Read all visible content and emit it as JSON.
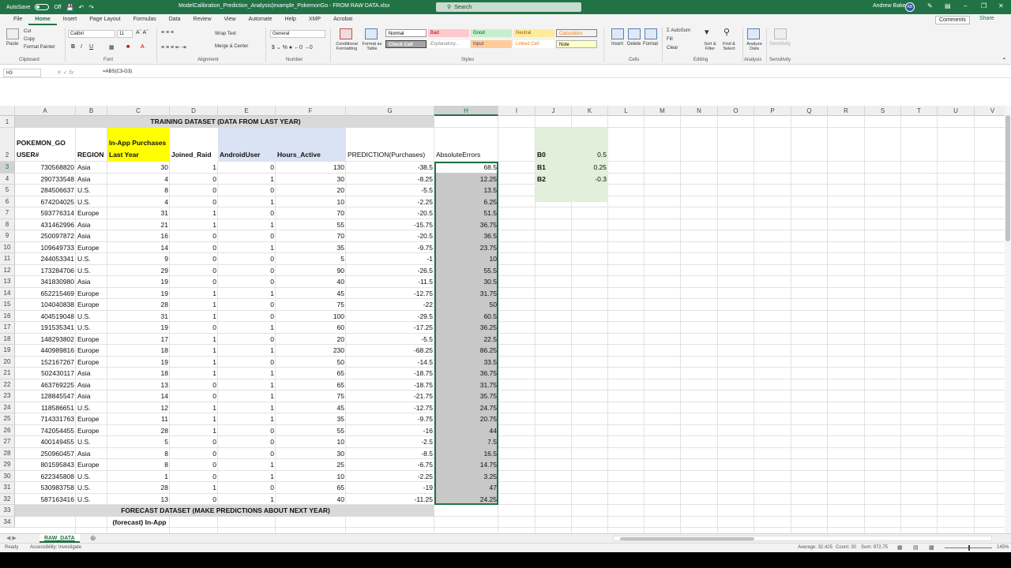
{
  "titlebar": {
    "autosave": "AutoSave",
    "autosave_state": "Off",
    "doc_title": "ModelCalibration_Prediction_Analysis(example_PokemonGo - FROM RAW DATA.xlsx",
    "search_placeholder": "Search",
    "user_name": "Andrew Baker",
    "user_initials": "AB"
  },
  "ribbon_tabs": [
    "File",
    "Home",
    "Insert",
    "Page Layout",
    "Formulas",
    "Data",
    "Review",
    "View",
    "Automate",
    "Help",
    "XMP",
    "Acrobat"
  ],
  "active_tab": "Home",
  "comments_label": "Comments",
  "share_label": "Share",
  "ribbon": {
    "clipboard": {
      "label": "Clipboard",
      "paste": "Paste",
      "cut": "Cut",
      "copy": "Copy",
      "format_painter": "Format Painter"
    },
    "font": {
      "label": "Font",
      "name": "Calibri",
      "size": "11"
    },
    "alignment": {
      "label": "Alignment",
      "wrap": "Wrap Text",
      "merge": "Merge & Center"
    },
    "number": {
      "label": "Number",
      "format": "General"
    },
    "styles": {
      "label": "Styles",
      "conditional": "Conditional Formatting",
      "format_table": "Format as Table",
      "cells": [
        "Normal",
        "Bad",
        "Good",
        "Neutral",
        "Calculation",
        "Check Cell",
        "Explanatory...",
        "Input",
        "Linked Cell",
        "Note"
      ]
    },
    "cells_group": {
      "label": "Cells",
      "insert": "Insert",
      "delete": "Delete",
      "format": "Format"
    },
    "editing": {
      "label": "Editing",
      "autosum": "AutoSum",
      "fill": "Fill",
      "clear": "Clear",
      "sort": "Sort & Filter",
      "find": "Find & Select"
    },
    "analysis": {
      "label": "Analysis",
      "analyze": "Analyze Data"
    },
    "sensitivity": {
      "label": "Sensitivity",
      "btn": "Sensitivity"
    }
  },
  "formula_bar": {
    "name_box": "H3",
    "formula": "=ABS(C3-G3)"
  },
  "columns": [
    "A",
    "B",
    "C",
    "D",
    "E",
    "F",
    "G",
    "H",
    "I",
    "J",
    "K",
    "L",
    "M",
    "N",
    "O",
    "P",
    "Q",
    "R",
    "S",
    "T",
    "U",
    "V"
  ],
  "headers": {
    "title": "TRAINING DATASET (DATA FROM LAST YEAR)",
    "a2_top": "POKEMON_GO",
    "a2": "USER#",
    "b2": "REGION",
    "c2_top": "In-App Purchases",
    "c2": "Last Year",
    "d2": "Joined_Raid",
    "e2": "AndroidUser",
    "f2": "Hours_Active",
    "g2": "PREDICTION(Purchases)",
    "h2": "AbsoluteErrors",
    "forecast_title": "FORECAST DATASET (MAKE PREDICTIONS ABOUT NEXT YEAR)",
    "c34": "(forecast) In-App"
  },
  "params": [
    {
      "name": "B0",
      "value": "0.5"
    },
    {
      "name": "B1",
      "value": "0.25"
    },
    {
      "name": "B2",
      "value": "-0.3"
    }
  ],
  "rows": [
    {
      "r": "3",
      "a": "730568820",
      "b": "Asia",
      "c": "30",
      "d": "1",
      "e": "0",
      "f": "130",
      "g": "-38.5",
      "h": "68.5"
    },
    {
      "r": "4",
      "a": "290733548",
      "b": "Asia",
      "c": "4",
      "d": "0",
      "e": "1",
      "f": "30",
      "g": "-8.25",
      "h": "12.25"
    },
    {
      "r": "5",
      "a": "284506637",
      "b": "U.S.",
      "c": "8",
      "d": "0",
      "e": "0",
      "f": "20",
      "g": "-5.5",
      "h": "13.5"
    },
    {
      "r": "6",
      "a": "674204025",
      "b": "U.S.",
      "c": "4",
      "d": "0",
      "e": "1",
      "f": "10",
      "g": "-2.25",
      "h": "6.25"
    },
    {
      "r": "7",
      "a": "593776314",
      "b": "Europe",
      "c": "31",
      "d": "1",
      "e": "0",
      "f": "70",
      "g": "-20.5",
      "h": "51.5"
    },
    {
      "r": "8",
      "a": "431462996",
      "b": "Asia",
      "c": "21",
      "d": "1",
      "e": "1",
      "f": "55",
      "g": "-15.75",
      "h": "36.75"
    },
    {
      "r": "9",
      "a": "250097872",
      "b": "Asia",
      "c": "16",
      "d": "0",
      "e": "0",
      "f": "70",
      "g": "-20.5",
      "h": "36.5"
    },
    {
      "r": "10",
      "a": "109649733",
      "b": "Europe",
      "c": "14",
      "d": "0",
      "e": "1",
      "f": "35",
      "g": "-9.75",
      "h": "23.75"
    },
    {
      "r": "11",
      "a": "244053341",
      "b": "U.S.",
      "c": "9",
      "d": "0",
      "e": "0",
      "f": "5",
      "g": "-1",
      "h": "10"
    },
    {
      "r": "12",
      "a": "173284706",
      "b": "U.S.",
      "c": "29",
      "d": "0",
      "e": "0",
      "f": "90",
      "g": "-26.5",
      "h": "55.5"
    },
    {
      "r": "13",
      "a": "341830980",
      "b": "Asia",
      "c": "19",
      "d": "0",
      "e": "0",
      "f": "40",
      "g": "-11.5",
      "h": "30.5"
    },
    {
      "r": "14",
      "a": "652215469",
      "b": "Europe",
      "c": "19",
      "d": "1",
      "e": "1",
      "f": "45",
      "g": "-12.75",
      "h": "31.75"
    },
    {
      "r": "15",
      "a": "104040838",
      "b": "Europe",
      "c": "28",
      "d": "1",
      "e": "0",
      "f": "75",
      "g": "-22",
      "h": "50"
    },
    {
      "r": "16",
      "a": "404519048",
      "b": "U.S.",
      "c": "31",
      "d": "1",
      "e": "0",
      "f": "100",
      "g": "-29.5",
      "h": "60.5"
    },
    {
      "r": "17",
      "a": "191535341",
      "b": "U.S.",
      "c": "19",
      "d": "0",
      "e": "1",
      "f": "60",
      "g": "-17.25",
      "h": "36.25"
    },
    {
      "r": "18",
      "a": "148293802",
      "b": "Europe",
      "c": "17",
      "d": "1",
      "e": "0",
      "f": "20",
      "g": "-5.5",
      "h": "22.5"
    },
    {
      "r": "19",
      "a": "440989816",
      "b": "Europe",
      "c": "18",
      "d": "1",
      "e": "1",
      "f": "230",
      "g": "-68.25",
      "h": "86.25"
    },
    {
      "r": "20",
      "a": "152167267",
      "b": "Europe",
      "c": "19",
      "d": "1",
      "e": "0",
      "f": "50",
      "g": "-14.5",
      "h": "33.5"
    },
    {
      "r": "21",
      "a": "502430117",
      "b": "Asia",
      "c": "18",
      "d": "1",
      "e": "1",
      "f": "65",
      "g": "-18.75",
      "h": "36.75"
    },
    {
      "r": "22",
      "a": "463769225",
      "b": "Asia",
      "c": "13",
      "d": "0",
      "e": "1",
      "f": "65",
      "g": "-18.75",
      "h": "31.75"
    },
    {
      "r": "23",
      "a": "128845547",
      "b": "Asia",
      "c": "14",
      "d": "0",
      "e": "1",
      "f": "75",
      "g": "-21.75",
      "h": "35.75"
    },
    {
      "r": "24",
      "a": "118586651",
      "b": "U.S.",
      "c": "12",
      "d": "1",
      "e": "1",
      "f": "45",
      "g": "-12.75",
      "h": "24.75"
    },
    {
      "r": "25",
      "a": "714331763",
      "b": "Europe",
      "c": "11",
      "d": "1",
      "e": "1",
      "f": "35",
      "g": "-9.75",
      "h": "20.75"
    },
    {
      "r": "26",
      "a": "742054455",
      "b": "Europe",
      "c": "28",
      "d": "1",
      "e": "0",
      "f": "55",
      "g": "-16",
      "h": "44"
    },
    {
      "r": "27",
      "a": "400149455",
      "b": "U.S.",
      "c": "5",
      "d": "0",
      "e": "0",
      "f": "10",
      "g": "-2.5",
      "h": "7.5"
    },
    {
      "r": "28",
      "a": "250960457",
      "b": "Asia",
      "c": "8",
      "d": "0",
      "e": "0",
      "f": "30",
      "g": "-8.5",
      "h": "16.5"
    },
    {
      "r": "29",
      "a": "801595843",
      "b": "Europe",
      "c": "8",
      "d": "0",
      "e": "1",
      "f": "25",
      "g": "-6.75",
      "h": "14.75"
    },
    {
      "r": "30",
      "a": "622345808",
      "b": "U.S.",
      "c": "1",
      "d": "0",
      "e": "1",
      "f": "10",
      "g": "-2.25",
      "h": "3.25"
    },
    {
      "r": "31",
      "a": "530983758",
      "b": "U.S.",
      "c": "28",
      "d": "1",
      "e": "0",
      "f": "65",
      "g": "-19",
      "h": "47"
    },
    {
      "r": "32",
      "a": "587163416",
      "b": "U.S.",
      "c": "13",
      "d": "0",
      "e": "1",
      "f": "40",
      "g": "-11.25",
      "h": "24.25"
    }
  ],
  "sheet_tab": "RAW_DATA",
  "status": {
    "ready": "Ready",
    "accessibility": "Accessibility: Investigate",
    "average": "Average: 32.425",
    "count": "Count: 30",
    "sum": "Sum: 972.75",
    "zoom": "145%"
  },
  "colors": {
    "excel_green": "#217346",
    "title_band": "#d9d9d9",
    "yellow_header": "#ffff00",
    "blue_header": "#dae3f3",
    "params_green": "#e2efda",
    "selection": "#c8c8c8"
  }
}
